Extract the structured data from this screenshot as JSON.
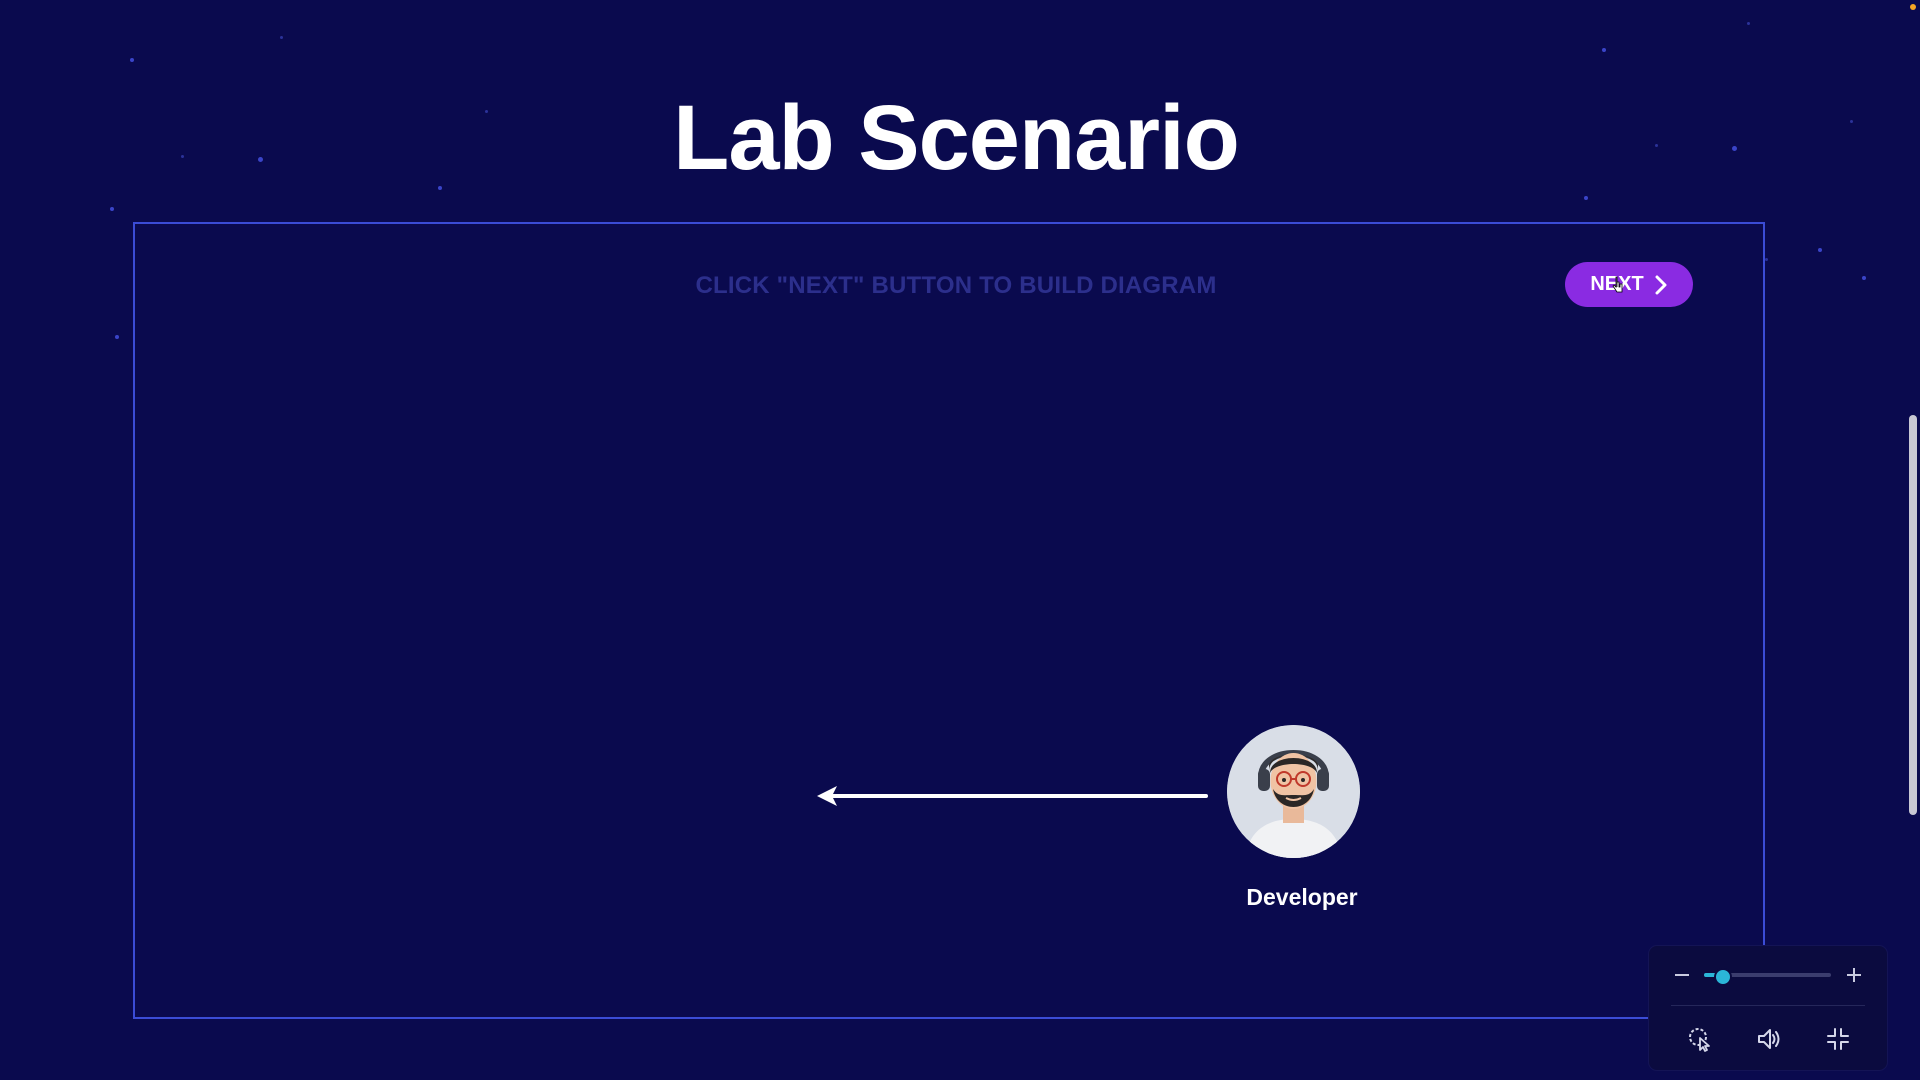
{
  "page": {
    "title": "Lab Scenario",
    "hint": "CLICK \"NEXT\" BUTTON TO BUILD DIAGRAM"
  },
  "next_button": {
    "label": "NEXT",
    "icon": "chevron-right-icon"
  },
  "diagram": {
    "actor_label": "Developer",
    "actor_icon": "developer-avatar",
    "connector_icon": "arrow-left-icon"
  },
  "player_controls": {
    "zoom_level": 0.15,
    "zoom_out_icon": "minus-icon",
    "zoom_in_icon": "plus-icon",
    "buttons": [
      "pointer-icon",
      "volume-icon",
      "exit-fullscreen-icon"
    ]
  },
  "colors": {
    "background": "#0a0a4e",
    "frame_border": "#3b4cd6",
    "next_button": "#8a2be2",
    "slider_accent": "#2bb6d8"
  }
}
